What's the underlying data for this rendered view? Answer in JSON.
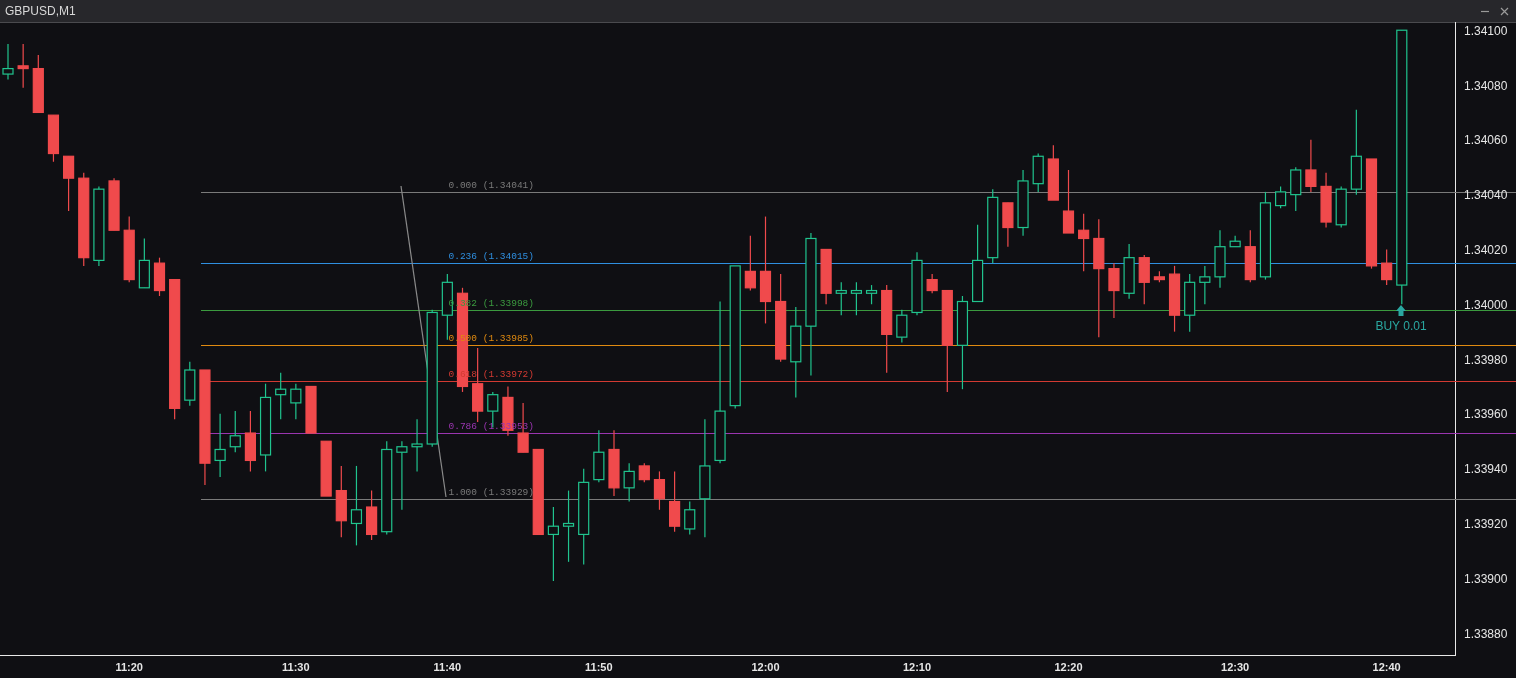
{
  "window": {
    "title": "GBPUSD,M1"
  },
  "chart": {
    "chart_data": {
      "type": "candlestick",
      "categories": [
        null,
        null,
        null,
        null,
        null,
        null,
        null,
        null,
        "11:20",
        null,
        null,
        null,
        null,
        null,
        null,
        null,
        null,
        null,
        null,
        "11:30",
        null,
        null,
        null,
        null,
        null,
        null,
        null,
        null,
        null,
        "11:40",
        null,
        null,
        null,
        null,
        null,
        null,
        null,
        null,
        null,
        "11:50",
        null,
        null,
        null,
        null,
        null,
        null,
        null,
        null,
        null,
        null,
        "12:00",
        null,
        null,
        null,
        null,
        null,
        null,
        null,
        null,
        null,
        "12:10",
        null,
        null,
        null,
        null,
        null,
        null,
        null,
        null,
        null,
        "12:20",
        null,
        null,
        null,
        null,
        null,
        null,
        null,
        null,
        null,
        null,
        "12:30",
        null,
        null,
        null,
        null,
        null,
        null,
        null,
        null,
        null,
        "12:40",
        null
      ],
      "ohlc": [
        [
          1.34084,
          1.34095,
          1.34082,
          1.34086
        ],
        [
          1.34087,
          1.34095,
          1.34079,
          1.34086
        ],
        [
          1.34086,
          1.34091,
          1.3407,
          1.3407
        ],
        [
          1.34069,
          1.34069,
          1.34052,
          1.34055
        ],
        [
          1.34054,
          1.34054,
          1.34034,
          1.34046
        ],
        [
          1.34046,
          1.34048,
          1.34014,
          1.34017
        ],
        [
          1.34016,
          1.34043,
          1.34014,
          1.34042
        ],
        [
          1.34045,
          1.34046,
          1.34027,
          1.34027
        ],
        [
          1.34027,
          1.34032,
          1.34008,
          1.34009
        ],
        [
          1.34006,
          1.34024,
          1.34006,
          1.34016
        ],
        [
          1.34015,
          1.34017,
          1.34003,
          1.34005
        ],
        [
          1.34009,
          1.34009,
          1.33958,
          1.33962
        ],
        [
          1.33965,
          1.33979,
          1.33963,
          1.33976
        ],
        [
          1.33976,
          1.33976,
          1.33934,
          1.33942
        ],
        [
          1.33943,
          1.3396,
          1.33937,
          1.33947
        ],
        [
          1.33948,
          1.33961,
          1.33946,
          1.33952
        ],
        [
          1.33953,
          1.33961,
          1.33939,
          1.33943
        ],
        [
          1.33945,
          1.33971,
          1.33939,
          1.33966
        ],
        [
          1.33967,
          1.33975,
          1.33958,
          1.33969
        ],
        [
          1.33964,
          1.33971,
          1.33958,
          1.33969
        ],
        [
          1.3397,
          1.3397,
          1.33953,
          1.33953
        ],
        [
          1.3395,
          1.3395,
          1.3393,
          1.3393
        ],
        [
          1.33932,
          1.33941,
          1.33915,
          1.33921
        ],
        [
          1.3392,
          1.33941,
          1.33912,
          1.33925
        ],
        [
          1.33926,
          1.33932,
          1.33914,
          1.33916
        ],
        [
          1.33917,
          1.3395,
          1.33916,
          1.33947
        ],
        [
          1.33946,
          1.3395,
          1.33925,
          1.33948
        ],
        [
          1.33948,
          1.33958,
          1.33939,
          1.33949
        ],
        [
          1.33949,
          1.33998,
          1.33948,
          1.33997
        ],
        [
          1.33996,
          1.34011,
          1.33987,
          1.34008
        ],
        [
          1.34004,
          1.34006,
          1.33968,
          1.3397
        ],
        [
          1.33971,
          1.33984,
          1.33957,
          1.33961
        ],
        [
          1.33961,
          1.33968,
          1.33955,
          1.33967
        ],
        [
          1.33966,
          1.3397,
          1.33952,
          1.33954
        ],
        [
          1.33953,
          1.33964,
          1.33946,
          1.33946
        ],
        [
          1.33947,
          1.33947,
          1.33916,
          1.33916
        ],
        [
          1.33916,
          1.33926,
          1.33899,
          1.33919
        ],
        [
          1.33919,
          1.33932,
          1.33906,
          1.3392
        ],
        [
          1.33916,
          1.3394,
          1.33905,
          1.33935
        ],
        [
          1.33936,
          1.33954,
          1.33935,
          1.33946
        ],
        [
          1.33947,
          1.33954,
          1.3393,
          1.33933
        ],
        [
          1.33933,
          1.33942,
          1.33928,
          1.33939
        ],
        [
          1.33941,
          1.33942,
          1.33935,
          1.33936
        ],
        [
          1.33936,
          1.33939,
          1.33925,
          1.33929
        ],
        [
          1.33928,
          1.33939,
          1.33917,
          1.33919
        ],
        [
          1.33918,
          1.33928,
          1.33916,
          1.33925
        ],
        [
          1.33929,
          1.33958,
          1.33915,
          1.33941
        ],
        [
          1.33943,
          1.34001,
          1.33942,
          1.33961
        ],
        [
          1.33963,
          1.34014,
          1.33962,
          1.34014
        ],
        [
          1.34012,
          1.34025,
          1.34005,
          1.34006
        ],
        [
          1.34012,
          1.34032,
          1.33993,
          1.34001
        ],
        [
          1.34001,
          1.34011,
          1.33979,
          1.3398
        ],
        [
          1.33979,
          1.33999,
          1.33966,
          1.33992
        ],
        [
          1.33992,
          1.34026,
          1.33974,
          1.34024
        ],
        [
          1.3402,
          1.3402,
          1.34,
          1.34004
        ],
        [
          1.34004,
          1.34008,
          1.33996,
          1.34005
        ],
        [
          1.34004,
          1.34008,
          1.33996,
          1.34005
        ],
        [
          1.34004,
          1.34007,
          1.34,
          1.34005
        ],
        [
          1.34005,
          1.34007,
          1.33975,
          1.33989
        ],
        [
          1.33988,
          1.33998,
          1.33986,
          1.33996
        ],
        [
          1.33997,
          1.34019,
          1.33996,
          1.34016
        ],
        [
          1.34009,
          1.34011,
          1.34004,
          1.34005
        ],
        [
          1.34005,
          1.34005,
          1.33968,
          1.33985
        ],
        [
          1.33985,
          1.34003,
          1.33969,
          1.34001
        ],
        [
          1.34001,
          1.34029,
          1.34001,
          1.34016
        ],
        [
          1.34017,
          1.34042,
          1.34015,
          1.34039
        ],
        [
          1.34037,
          1.34037,
          1.34021,
          1.34028
        ],
        [
          1.34028,
          1.34049,
          1.34025,
          1.34045
        ],
        [
          1.34044,
          1.34055,
          1.34041,
          1.34054
        ],
        [
          1.34053,
          1.34058,
          1.34038,
          1.34038
        ],
        [
          1.34034,
          1.34049,
          1.34026,
          1.34026
        ],
        [
          1.34027,
          1.34033,
          1.34012,
          1.34024
        ],
        [
          1.34024,
          1.34031,
          1.33988,
          1.34013
        ],
        [
          1.34013,
          1.34015,
          1.33995,
          1.34005
        ],
        [
          1.34004,
          1.34022,
          1.34002,
          1.34017
        ],
        [
          1.34017,
          1.34018,
          1.34,
          1.34008
        ],
        [
          1.3401,
          1.34012,
          1.34008,
          1.34009
        ],
        [
          1.34011,
          1.34014,
          1.3399,
          1.33996
        ],
        [
          1.33996,
          1.34011,
          1.3399,
          1.34008
        ],
        [
          1.34008,
          1.34014,
          1.34,
          1.3401
        ],
        [
          1.3401,
          1.34027,
          1.34006,
          1.34021
        ],
        [
          1.34021,
          1.34025,
          1.34021,
          1.34023
        ],
        [
          1.34021,
          1.34027,
          1.34008,
          1.34009
        ],
        [
          1.3401,
          1.34041,
          1.34009,
          1.34037
        ],
        [
          1.34036,
          1.34043,
          1.34035,
          1.34041
        ],
        [
          1.3404,
          1.3405,
          1.34034,
          1.34049
        ],
        [
          1.34049,
          1.3406,
          1.34041,
          1.34043
        ],
        [
          1.34043,
          1.34048,
          1.34028,
          1.3403
        ],
        [
          1.34029,
          1.34043,
          1.34028,
          1.34042
        ],
        [
          1.34042,
          1.34071,
          1.3404,
          1.34054
        ],
        [
          1.34053,
          1.34053,
          1.34013,
          1.34014
        ],
        [
          1.34015,
          1.3402,
          1.34007,
          1.34009
        ],
        [
          1.34007,
          1.341,
          1.34,
          1.341
        ]
      ],
      "ylim": [
        1.33872,
        1.34103
      ],
      "yticks": [
        {
          "value": 1.341,
          "label": "1.34100"
        },
        {
          "value": 1.3408,
          "label": "1.34080"
        },
        {
          "value": 1.3406,
          "label": "1.34060"
        },
        {
          "value": 1.3404,
          "label": "1.34040"
        },
        {
          "value": 1.3402,
          "label": "1.34020"
        },
        {
          "value": 1.34,
          "label": "1.34000"
        },
        {
          "value": 1.3398,
          "label": "1.33980"
        },
        {
          "value": 1.3396,
          "label": "1.33960"
        },
        {
          "value": 1.3394,
          "label": "1.33940"
        },
        {
          "value": 1.3392,
          "label": "1.33920"
        },
        {
          "value": 1.339,
          "label": "1.33900"
        },
        {
          "value": 1.3388,
          "label": "1.33880"
        }
      ],
      "ref_lines": [
        {
          "axis": "y",
          "value": 1.34041,
          "label": "0.000 (1.34041)",
          "color": "#7a7a7a"
        },
        {
          "axis": "y",
          "value": 1.34015,
          "label": "0.236 (1.34015)",
          "color": "#2f8fe0"
        },
        {
          "axis": "y",
          "value": 1.33998,
          "label": "0.382 (1.33998)",
          "color": "#3b9a3f"
        },
        {
          "axis": "y",
          "value": 1.33985,
          "label": "0.500 (1.33985)",
          "color": "#e08a10"
        },
        {
          "axis": "y",
          "value": 1.33972,
          "label": "0.618 (1.33972)",
          "color": "#d23a32"
        },
        {
          "axis": "y",
          "value": 1.33953,
          "label": "0.786 (1.33953)",
          "color": "#9a35b0"
        },
        {
          "axis": "y",
          "value": 1.33929,
          "label": "1.000 (1.33929)",
          "color": "#7a7a7a"
        }
      ]
    }
  },
  "order": {
    "label": "BUY 0.01"
  }
}
